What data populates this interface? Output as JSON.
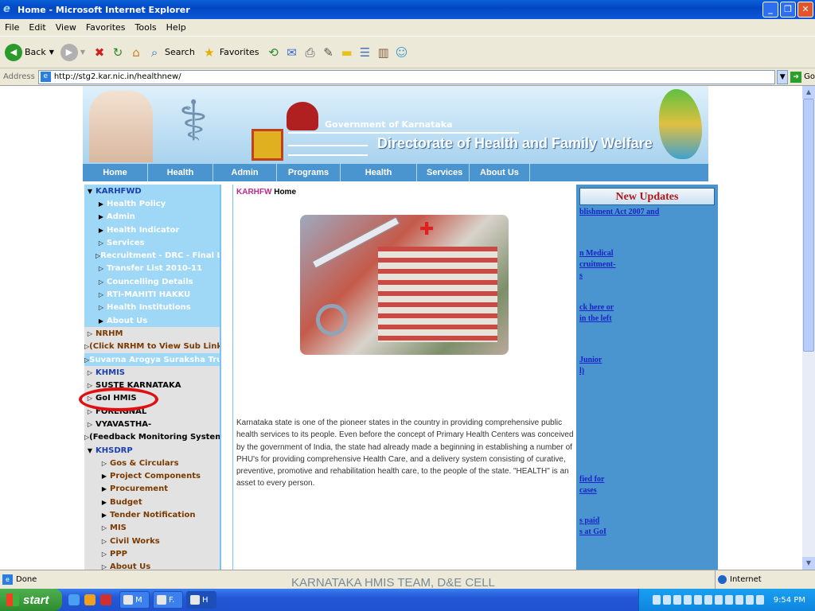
{
  "window": {
    "title": "Home - Microsoft Internet Explorer",
    "buttons": [
      "_",
      "❐",
      "✕"
    ]
  },
  "menu": [
    "File",
    "Edit",
    "View",
    "Favorites",
    "Tools",
    "Help"
  ],
  "toolbar": {
    "back": "Back",
    "search": "Search",
    "favorites": "Favorites"
  },
  "address": {
    "label": "Address",
    "url": "http://stg2.kar.nic.in/healthnew/",
    "go": "Go"
  },
  "banner": {
    "gov": "Government of Karnataka",
    "dept": "Directorate of Health and Family Welfare"
  },
  "nav": [
    "Home",
    "Health Policy",
    "Admin",
    "Programs",
    "Health Indicator",
    "Services",
    "About Us"
  ],
  "sidebar": [
    {
      "label": "KARHFWD",
      "style": "top",
      "arrow": "▼"
    },
    {
      "label": "Health Policy",
      "style": "sub",
      "arrow": "▶"
    },
    {
      "label": "Admin",
      "style": "sub",
      "arrow": "▶"
    },
    {
      "label": "Health Indicator",
      "style": "sub",
      "arrow": "▶"
    },
    {
      "label": "Services",
      "style": "sub",
      "arrow": "▷"
    },
    {
      "label": "Recruitment - DRC - Final List",
      "style": "sub",
      "arrow": "▷"
    },
    {
      "label": "Transfer List 2010-11",
      "style": "sub",
      "arrow": "▷"
    },
    {
      "label": "Councelling Details",
      "style": "sub",
      "arrow": "▷"
    },
    {
      "label": "RTI-MAHITI HAKKU",
      "style": "sub",
      "arrow": "▷"
    },
    {
      "label": "Health Institutions",
      "style": "sub",
      "arrow": "▷"
    },
    {
      "label": "About Us",
      "style": "sub",
      "arrow": "▶"
    },
    {
      "label": "NRHM",
      "style": "grey",
      "arrow": "▷"
    },
    {
      "label": "(Click NRHM to View Sub Links)",
      "style": "grey",
      "arrow": "▷"
    },
    {
      "label": "Suvarna Arogya Suraksha Trust",
      "style": "bar",
      "arrow": "▷"
    },
    {
      "label": "KHMIS",
      "style": "grey-blue",
      "arrow": "▷"
    },
    {
      "label": "SUSTE KARNATAKA",
      "style": "grey-black",
      "arrow": "▷"
    },
    {
      "label": "GoI HMIS",
      "style": "grey-black",
      "arrow": "▷"
    },
    {
      "label": "FOREIGNAL",
      "style": "grey-black",
      "arrow": "▷"
    },
    {
      "label": "VYAVASTHA-",
      "style": "grey-black",
      "arrow": "▷"
    },
    {
      "label": "(Feedback Monitoring System)",
      "style": "grey-black",
      "arrow": "▷"
    },
    {
      "label": "KHSDRP",
      "style": "grey-blue",
      "arrow": "▼"
    },
    {
      "label": "Gos & Circulars",
      "style": "subg",
      "arrow": "▷"
    },
    {
      "label": "Project Components",
      "style": "subg",
      "arrow": "▶"
    },
    {
      "label": "Procurement",
      "style": "subg",
      "arrow": "▶"
    },
    {
      "label": "Budget",
      "style": "subg",
      "arrow": "▶"
    },
    {
      "label": "Tender Notification",
      "style": "subg",
      "arrow": "▶"
    },
    {
      "label": "MIS",
      "style": "subg",
      "arrow": "▷"
    },
    {
      "label": "Civil Works",
      "style": "subg",
      "arrow": "▷"
    },
    {
      "label": "PPP",
      "style": "subg",
      "arrow": "▷"
    },
    {
      "label": "About Us",
      "style": "subg",
      "arrow": "▷"
    }
  ],
  "crumb": {
    "site": "KARHFW",
    "page": "Home"
  },
  "body_text": "Karnataka state is one of the pioneer states in the country in providing comprehensive public health services to its people. Even before the concept of Primary Health Centers was conceived by the government of India, the state had already made a beginning in establishing a number of PHU's for providing comprehensive Health Care, and a delivery system consisting of curative, preventive, promotive and rehabilitation health care, to the people of the state. \"HEALTH\" is an asset to every person.",
  "updates": {
    "title": "New Updates",
    "items": [
      {
        "lines": [
          "blishment Act 2007 and"
        ]
      },
      {
        "lines": [
          "n Medical",
          "cruitment-",
          "s"
        ]
      },
      {
        "lines": [
          "ck here or",
          " in the left"
        ]
      },
      {
        "lines": [
          " Junior",
          "l)"
        ]
      },
      {
        "lines": [
          "fied for",
          " cases"
        ]
      },
      {
        "lines": [
          "s paid",
          "s at GoI"
        ]
      }
    ]
  },
  "status": {
    "text": "Done",
    "zone": "Internet"
  },
  "footnote": "KARNATAKA HMIS TEAM, D&E CELL",
  "taskbar": {
    "start": "start",
    "tasks": [
      "M",
      "F.",
      "H"
    ],
    "time": "9:54 PM"
  }
}
